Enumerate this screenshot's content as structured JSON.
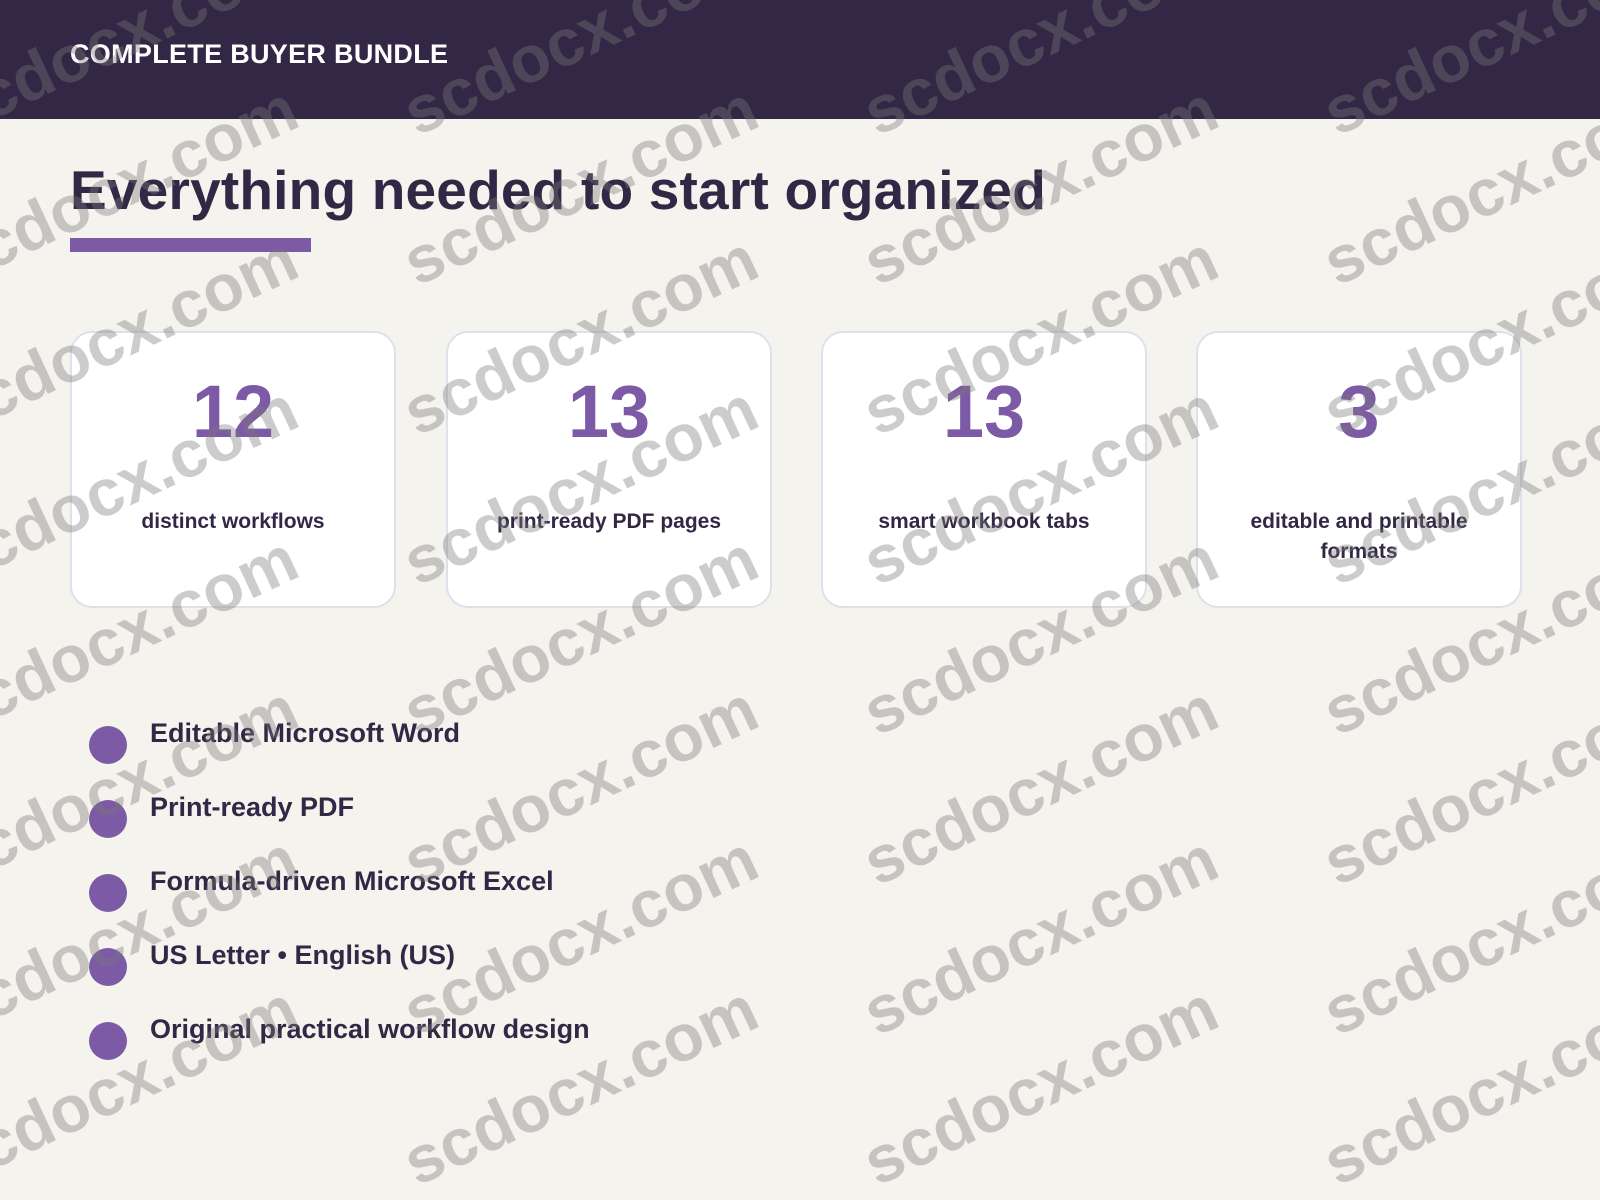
{
  "header": {
    "title": "COMPLETE BUYER BUNDLE"
  },
  "main": {
    "title": "Everything needed to start organized",
    "stats": [
      {
        "value": "12",
        "label": "distinct workflows"
      },
      {
        "value": "13",
        "label": "print-ready PDF pages"
      },
      {
        "value": "13",
        "label": "smart workbook tabs"
      },
      {
        "value": "3",
        "label": "editable and printable formats"
      }
    ],
    "features": [
      "Editable Microsoft Word",
      "Print-ready PDF",
      "Formula-driven Microsoft Excel",
      "US Letter • English (US)",
      "Original practical workflow design"
    ]
  },
  "watermark": {
    "text": "scdocx.com"
  },
  "colors": {
    "header_background": "#322846",
    "page_background": "#f5f3ee",
    "accent": "#7d5aa5",
    "text": "#322846",
    "card_border": "#dde1ea"
  }
}
